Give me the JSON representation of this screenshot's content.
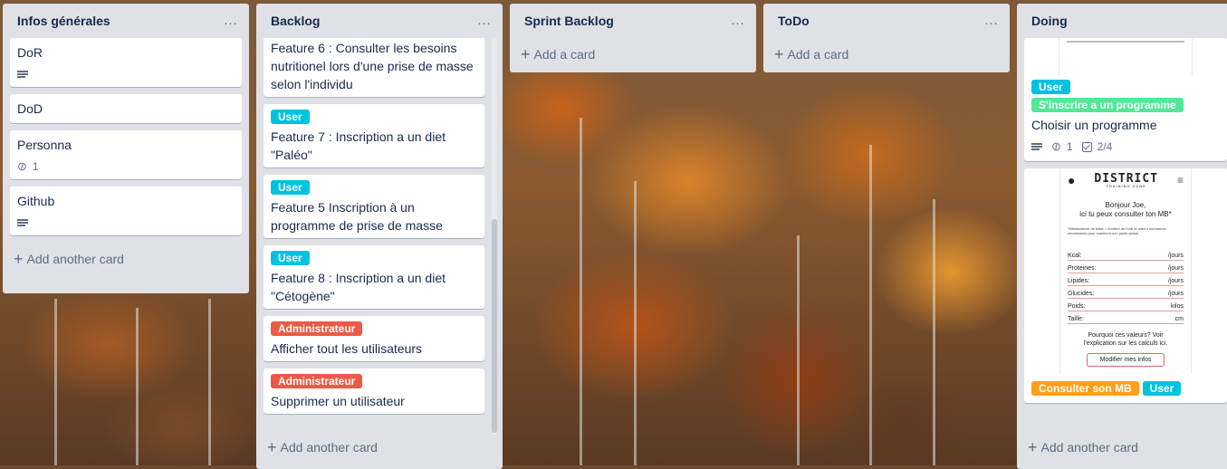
{
  "colors": {
    "label_cyan": "#00c2e0",
    "label_red": "#eb5a46",
    "label_green": "#51e898",
    "label_orange": "#ff9f1a",
    "list_bg": "#dfe1e6"
  },
  "lists": [
    {
      "title": "Infos générales",
      "more_icon": "…",
      "cards": [
        {
          "title": "DoR",
          "desc": true
        },
        {
          "title": "DoD"
        },
        {
          "title": "Personna",
          "attachments": "1"
        },
        {
          "title": "Github",
          "desc": true
        }
      ],
      "add_label": "Add another card"
    },
    {
      "title": "Backlog",
      "more_icon": "…",
      "cards": [
        {
          "title": "Feature 6 : Consulter les besoins nutritionel lors d'une prise de masse selon l'individu"
        },
        {
          "label": "User",
          "title": "Feature 7 : Inscription a un diet \"Paléo\""
        },
        {
          "label": "User",
          "title": "Feature 5 Inscription à un programme de prise de masse"
        },
        {
          "label": "User",
          "title": "Feature 8 : Inscription a un diet \"Cétogène\""
        },
        {
          "label": "Administrateur",
          "title": "Afficher tout les utilisateurs"
        },
        {
          "label": "Administrateur",
          "title": "Supprimer un utilisateur"
        }
      ],
      "add_label": "Add another card"
    },
    {
      "title": "Sprint Backlog",
      "more_icon": "…",
      "add_label": "Add a card"
    },
    {
      "title": "ToDo",
      "more_icon": "…",
      "add_label": "Add a card"
    },
    {
      "title": "Doing",
      "cards": [
        {
          "labels": [
            "User",
            "S'inscrire a un programme"
          ],
          "title": "Choisir un programme",
          "attachments": "1",
          "checklist": "2/4"
        },
        {
          "labels": [
            "Consulter son MB",
            "User"
          ]
        }
      ],
      "add_label": "Add another card"
    }
  ],
  "mockup": {
    "logo": "DISTRICT",
    "sub": "TRAINING ZONE",
    "greeting_line1": "Bonjour Joe,",
    "greeting_line2": "ici tu peux consulter ton MB*",
    "note": "*Métabolisme de base = nombre de Kcal et macro nutriments nécessaires pour maintenir son poids actuel.",
    "rows": [
      {
        "label": "Kcal:",
        "unit": "/jours"
      },
      {
        "label": "Proteines:",
        "unit": "/jours"
      },
      {
        "label": "Lipides:",
        "unit": "/jours"
      },
      {
        "label": "Glucides:",
        "unit": "/jours"
      },
      {
        "label": "Poids:",
        "unit": "kilos"
      },
      {
        "label": "Taille:",
        "unit": "cm"
      }
    ],
    "why_line1": "Pourquoi ces valeurs? Voir",
    "why_line2": "l'explication sur les calculs ici.",
    "button": "Modifier mes infos"
  }
}
